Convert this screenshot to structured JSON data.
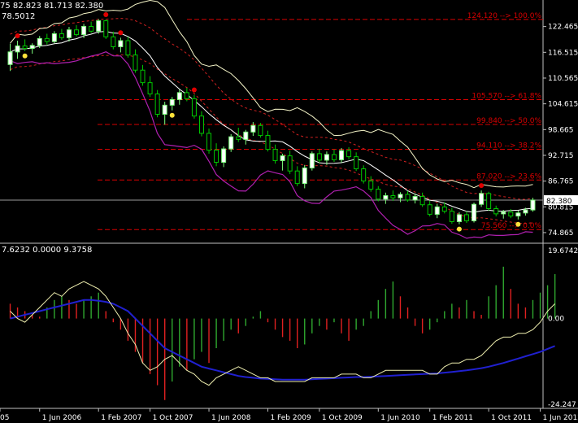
{
  "chart_data": [
    {
      "type": "candlestick",
      "header_text": "75 82.823 81.713 82.380",
      "indicator_text": "78.5012",
      "ylim": [
        72.6,
        128.6
      ],
      "y_ticks": [
        "122.465",
        "116.515",
        "110.565",
        "104.615",
        "98.665",
        "92.715",
        "86.765",
        "80.815",
        "74.865"
      ],
      "y_tick_values": [
        122.465,
        116.515,
        110.565,
        104.615,
        98.665,
        92.715,
        86.765,
        80.815,
        74.865
      ],
      "current_price": "82.380",
      "current_price_value": 82.38,
      "fib_levels": [
        {
          "label": "124.120 --> 100.0%",
          "value": 124.12
        },
        {
          "label": "105.570 --> 61.8%",
          "value": 105.57
        },
        {
          "label": "99.840 --> 50.0%",
          "value": 99.84
        },
        {
          "label": "94.110 --> 38.2%",
          "value": 94.11
        },
        {
          "label": "87.020 --> 23.6%",
          "value": 87.02
        },
        {
          "label": "75.560 --> 0.0%",
          "value": 75.56
        }
      ],
      "candles": [
        [
          113.7,
          118.5,
          112.2,
          116.6
        ],
        [
          116.6,
          119.2,
          115.0,
          118.0
        ],
        [
          118.0,
          119.5,
          116.8,
          117.4
        ],
        [
          117.4,
          118.6,
          116.2,
          118.1
        ],
        [
          118.1,
          120.3,
          117.5,
          119.7
        ],
        [
          119.7,
          120.8,
          118.3,
          119.0
        ],
        [
          119.0,
          121.4,
          118.6,
          120.8
        ],
        [
          120.8,
          121.9,
          119.4,
          119.9
        ],
        [
          119.9,
          122.4,
          119.0,
          121.7
        ],
        [
          121.7,
          122.8,
          120.2,
          120.6
        ],
        [
          120.6,
          123.1,
          119.8,
          122.5
        ],
        [
          122.5,
          123.6,
          121.0,
          121.4
        ],
        [
          121.4,
          124.2,
          120.8,
          123.8
        ],
        [
          123.8,
          124.1,
          119.6,
          120.1
        ],
        [
          120.1,
          121.3,
          117.2,
          117.8
        ],
        [
          117.8,
          119.9,
          116.5,
          119.2
        ],
        [
          119.2,
          120.1,
          115.3,
          115.9
        ],
        [
          115.9,
          117.2,
          111.8,
          112.4
        ],
        [
          112.4,
          113.6,
          108.8,
          109.5
        ],
        [
          109.5,
          111.0,
          106.2,
          106.9
        ],
        [
          106.9,
          107.8,
          101.5,
          102.2
        ],
        [
          102.2,
          105.1,
          99.8,
          104.3
        ],
        [
          104.3,
          106.2,
          103.1,
          105.6
        ],
        [
          105.6,
          107.9,
          104.4,
          107.2
        ],
        [
          107.2,
          108.3,
          105.2,
          105.8
        ],
        [
          105.8,
          106.7,
          101.2,
          101.8
        ],
        [
          101.8,
          102.9,
          97.1,
          97.8
        ],
        [
          97.8,
          98.9,
          93.1,
          93.9
        ],
        [
          93.9,
          95.5,
          90.2,
          91.1
        ],
        [
          91.1,
          94.8,
          90.0,
          94.2
        ],
        [
          94.2,
          97.6,
          93.5,
          97.0
        ],
        [
          97.0,
          99.1,
          95.8,
          96.4
        ],
        [
          96.4,
          98.6,
          95.2,
          98.1
        ],
        [
          98.1,
          100.4,
          97.2,
          99.6
        ],
        [
          99.6,
          100.2,
          96.8,
          97.3
        ],
        [
          97.3,
          98.4,
          93.6,
          94.1
        ],
        [
          94.1,
          95.2,
          90.8,
          91.5
        ],
        [
          91.5,
          93.1,
          89.2,
          92.6
        ],
        [
          92.6,
          93.8,
          88.4,
          89.1
        ],
        [
          89.1,
          90.2,
          85.6,
          86.2
        ],
        [
          86.2,
          90.5,
          85.1,
          89.8
        ],
        [
          89.8,
          93.6,
          89.2,
          93.1
        ],
        [
          93.1,
          94.2,
          91.0,
          91.6
        ],
        [
          91.6,
          93.6,
          90.5,
          92.9
        ],
        [
          92.9,
          94.1,
          91.2,
          91.7
        ],
        [
          91.7,
          94.4,
          91.0,
          93.8
        ],
        [
          93.8,
          94.6,
          91.8,
          92.4
        ],
        [
          92.4,
          93.4,
          89.1,
          89.6
        ],
        [
          89.6,
          90.4,
          86.2,
          86.8
        ],
        [
          86.8,
          87.9,
          84.3,
          84.9
        ],
        [
          84.9,
          85.6,
          82.1,
          82.6
        ],
        [
          82.6,
          84.1,
          81.5,
          83.4
        ],
        [
          83.4,
          84.6,
          82.2,
          82.9
        ],
        [
          82.9,
          84.2,
          81.9,
          83.7
        ],
        [
          83.7,
          84.5,
          82.0,
          82.4
        ],
        [
          82.4,
          83.9,
          81.6,
          83.2
        ],
        [
          83.2,
          84.1,
          80.8,
          81.3
        ],
        [
          81.3,
          82.2,
          78.6,
          79.1
        ],
        [
          79.1,
          81.5,
          78.2,
          80.8
        ],
        [
          80.8,
          81.9,
          79.3,
          79.8
        ],
        [
          79.8,
          80.6,
          76.9,
          77.4
        ],
        [
          77.4,
          79.6,
          76.8,
          79.0
        ],
        [
          79.0,
          79.8,
          77.1,
          77.6
        ],
        [
          77.6,
          81.8,
          77.2,
          81.4
        ],
        [
          81.4,
          84.6,
          80.8,
          83.9
        ],
        [
          83.9,
          84.3,
          79.9,
          80.4
        ],
        [
          80.4,
          81.1,
          78.6,
          79.2
        ],
        [
          79.2,
          80.1,
          78.1,
          79.6
        ],
        [
          79.6,
          80.3,
          78.2,
          78.7
        ],
        [
          78.7,
          79.9,
          77.9,
          79.4
        ],
        [
          79.4,
          80.6,
          78.8,
          80.1
        ],
        [
          80.1,
          82.9,
          79.7,
          82.38
        ]
      ],
      "upper_markers": [
        1,
        13,
        15,
        25,
        64
      ],
      "lower_markers": [
        2,
        22,
        61,
        69
      ],
      "x_labels": [
        "05",
        "1 Jun 2006",
        "1 Feb 2007",
        "1 Oct 2007",
        "1 Jun 2008",
        "1 Feb 2009",
        "1 Oct 2009",
        "1 Jun 2010",
        "1 Feb 2011",
        "1 Oct 2011",
        "1 Jun 2012"
      ],
      "x_label_index": [
        0,
        4,
        12,
        19,
        27,
        35,
        42,
        50,
        57,
        65,
        72
      ],
      "colors": {
        "bull": "#7dff7d",
        "bear": "#00c800",
        "fib": "#d90000",
        "envelope": "#d02020",
        "band_upper": "#f5f5c8",
        "band_lower": "#b020b0",
        "sma": "#ffffff",
        "upper_marker": "#e00000",
        "lower_marker": "#ffe23a"
      }
    },
    {
      "type": "macd",
      "header_text": "7.6232 0.0000 9.3758",
      "ylim": [
        -24.247,
        19.6742
      ],
      "y_ticks": [
        "19.6742",
        "0.00",
        "-24.247"
      ],
      "y_tick_values": [
        19.6742,
        0.0,
        -24.247
      ],
      "histogram": [
        4,
        3,
        2,
        1,
        0.5,
        3,
        5,
        6,
        5,
        4,
        5,
        6,
        7,
        2,
        -1,
        -3,
        -6,
        -9,
        -12,
        -15,
        -18,
        -22,
        -17,
        -13,
        -14,
        -11,
        -9,
        -12,
        -8,
        -6,
        -3,
        -4,
        -2,
        0.5,
        2,
        -1,
        -3,
        -5,
        -6,
        -8,
        -7,
        -4,
        -2,
        -3,
        -1,
        -4,
        -6,
        -3,
        -2,
        2,
        5,
        8,
        10,
        6,
        3,
        -2,
        -4,
        -3,
        -1,
        2,
        4,
        3,
        5,
        2,
        1,
        6,
        9,
        14,
        8,
        4,
        3,
        5,
        7,
        9,
        12
      ],
      "macd_line": [
        2,
        0,
        -1,
        1,
        3,
        5,
        7,
        6,
        8,
        9,
        10,
        9,
        8,
        6,
        3,
        0,
        -4,
        -7,
        -12,
        -14,
        -13,
        -11,
        -10,
        -12,
        -14,
        -15,
        -17,
        -18,
        -16,
        -15,
        -14,
        -13,
        -14,
        -15,
        -16,
        -16,
        -17,
        -17,
        -17,
        -17,
        -17,
        -16,
        -16,
        -16,
        -16,
        -15,
        -15,
        -15,
        -16,
        -16,
        -15,
        -14,
        -14,
        -14,
        -14,
        -14,
        -14,
        -15,
        -15,
        -13,
        -12,
        -12,
        -11,
        -11,
        -10,
        -8,
        -6,
        -5,
        -5,
        -4,
        -4,
        -3,
        -1,
        2,
        4
      ],
      "signal_line": [
        0,
        0.5,
        1,
        1.5,
        2,
        2.5,
        3,
        3.5,
        4,
        4.5,
        5,
        5,
        4.8,
        4.5,
        4,
        3,
        2,
        0,
        -2,
        -4,
        -6,
        -8,
        -9,
        -10,
        -11,
        -12,
        -13,
        -13.5,
        -14,
        -14.5,
        -15,
        -15.5,
        -15.8,
        -16,
        -16.2,
        -16.3,
        -16.4,
        -16.5,
        -16.5,
        -16.5,
        -16.5,
        -16.4,
        -16.3,
        -16.2,
        -16.1,
        -16,
        -15.9,
        -15.8,
        -15.8,
        -15.7,
        -15.6,
        -15.5,
        -15.4,
        -15.3,
        -15.2,
        -15.1,
        -15,
        -14.9,
        -14.8,
        -14.6,
        -14.4,
        -14.2,
        -14,
        -13.7,
        -13.4,
        -13,
        -12.5,
        -12,
        -11.4,
        -10.8,
        -10.2,
        -9.6,
        -9,
        -8.2,
        -7.4
      ],
      "colors": {
        "hist_pos": "#2fa82f",
        "hist_neg": "#e02020",
        "macd": "#f0f0b0",
        "signal": "#2020d0"
      }
    }
  ]
}
